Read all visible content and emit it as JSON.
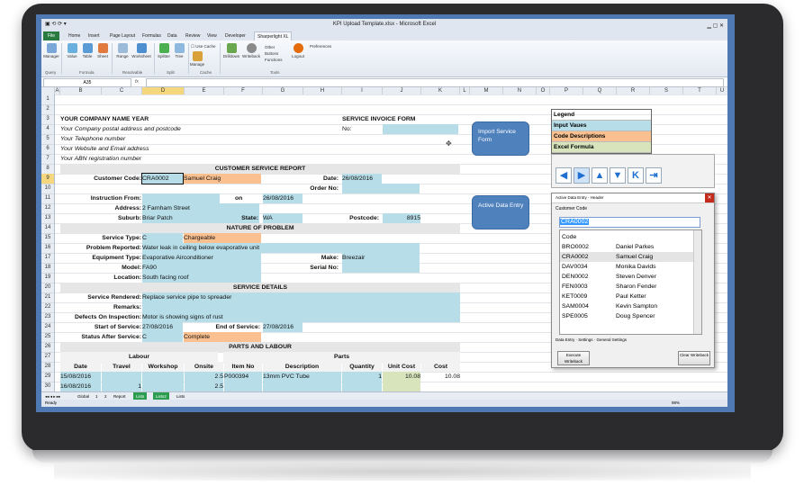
{
  "window": {
    "title": "KPI Upload Template.xlsx - Microsoft Excel"
  },
  "tabs": [
    "File",
    "Home",
    "Insert",
    "Page Layout",
    "Formulas",
    "Data",
    "Review",
    "View",
    "Developer",
    "Sharperlight XL"
  ],
  "ribbon": {
    "buttons": [
      "Manager",
      "Value",
      "Table",
      "Sheet",
      "Range",
      "Worksheet",
      "Splitter",
      "Tree",
      "Use Cache",
      "Manage",
      "Drilldown",
      "Writeback",
      "Other",
      "Buttons",
      "Functions",
      "Logout",
      "Preferences"
    ],
    "groups": [
      "Query",
      "Formula",
      "Resolvable",
      "Split",
      "Cache",
      "Tools"
    ]
  },
  "namebox": "A35",
  "columns": [
    "A",
    "B",
    "C",
    "D",
    "E",
    "F",
    "G",
    "H",
    "I",
    "J",
    "K",
    "L",
    "M",
    "N",
    "O",
    "P",
    "Q",
    "R",
    "S",
    "T",
    "U",
    "V"
  ],
  "rows": [
    "1",
    "2",
    "3",
    "4",
    "5",
    "6",
    "7",
    "8",
    "9",
    "10",
    "11",
    "12",
    "13",
    "14",
    "15",
    "16",
    "17",
    "18",
    "19",
    "20",
    "21",
    "22",
    "23",
    "24",
    "25",
    "26",
    "27",
    "28",
    "29",
    "30"
  ],
  "sheet": {
    "company": "YOUR COMPANY NAME YEAR",
    "address": "Your Company postal address and postcode",
    "phone": "Your Telephone number",
    "web": "Your Website and Email address",
    "abn": "Your ABN registration number",
    "invoice_title": "SERVICE INVOICE FORM",
    "no_label": "No:",
    "report_title": "CUSTOMER SERVICE REPORT",
    "customer_code_label": "Customer Code:",
    "customer_code": "CRA0002",
    "customer_name": "Samuel Craig",
    "date_label": "Date:",
    "date": "26/08/2016",
    "order_label": "Order No:",
    "instruction_label": "Instruction From:",
    "on_label": "on",
    "instruction_date": "26/08/2016",
    "address_label": "Address:",
    "address_value": "2 Farnham Street",
    "suburb_label": "Suburb:",
    "suburb": "Briar Patch",
    "state_label": "State:",
    "state": "WA",
    "postcode_label": "Postcode:",
    "postcode": "8915",
    "nature_title": "NATURE OF PROBLEM",
    "service_type_label": "Service Type:",
    "service_type": "C",
    "service_type_desc": "Chargeable",
    "problem_label": "Problem Reported:",
    "problem": "Water leak in ceiling below evaporative unit",
    "equipment_label": "Equipment Type:",
    "equipment": "Evaporative Airconditioner",
    "make_label": "Make:",
    "make": "Breezair",
    "model_label": "Model:",
    "model": "FA90",
    "serial_label": "Serial No:",
    "location_label": "Location:",
    "location": "South facing roof",
    "details_title": "SERVICE DETAILS",
    "rendered_label": "Service Rendered:",
    "rendered": "Replace service pipe to spreader",
    "remarks_label": "Remarks:",
    "defects_label": "Defects On Inspection:",
    "defects": "Motor is showing signs of rust",
    "start_label": "Start of Service:",
    "start": "27/08/2016",
    "end_label": "End of Service:",
    "end": "27/08/2016",
    "status_label": "Status After Service:",
    "status": "C",
    "status_desc": "Complete",
    "parts_title": "PARTS AND LABOUR",
    "labour_label": "Labour",
    "parts_label": "Parts",
    "table_headers": [
      "Date",
      "Travel",
      "Workshop",
      "Onsite",
      "Item No",
      "Description",
      "Quantity",
      "Unit Cost",
      "Cost"
    ],
    "table_rows": [
      [
        "15/08/2016",
        "",
        "",
        "2.5",
        "P000394",
        "13mm PVC Tube",
        "1",
        "10.08",
        "10.08"
      ],
      [
        "16/08/2016",
        "1",
        "",
        "2.5",
        "",
        "",
        "",
        "",
        ""
      ]
    ]
  },
  "nav": {
    "import": "Import Service Form",
    "active": "Active Data Entry"
  },
  "legend": {
    "title": "Legend",
    "items": [
      "Input Vaues",
      "Code Descriptions",
      "Excel Formula"
    ],
    "colors": [
      "#b6dde8",
      "#fac090",
      "#d7e4bc"
    ]
  },
  "arrows": [
    "arrow-left-icon",
    "arrow-right-icon",
    "arrow-up-icon",
    "arrow-down-icon",
    "first-icon",
    "last-icon"
  ],
  "dialog": {
    "title": "Active Data Entry - Header",
    "field_label": "Customer Code",
    "search": "CRA0002",
    "list_header": "Code",
    "items": [
      [
        "BRO0002",
        "Daniel Parkes"
      ],
      [
        "CRA0002",
        "Samuel Craig"
      ],
      [
        "DAV0034",
        "Monika Davids"
      ],
      [
        "DEN0002",
        "Steven Denver"
      ],
      [
        "FEN0003",
        "Sharon Fender"
      ],
      [
        "KET0009",
        "Paul Ketter"
      ],
      [
        "SAM0004",
        "Kevin Sampton"
      ],
      [
        "SPE0005",
        "Doug Spencer"
      ]
    ],
    "tabs": [
      "Data Entry",
      "Settings",
      "General Settings"
    ],
    "btn_left": "Execute Writeback",
    "btn_right": "Clear Writeback"
  },
  "sheet_tabs": [
    "Global",
    "1",
    "2",
    "Report",
    "Lists",
    "Lists2",
    "Lists"
  ],
  "status": {
    "left": "Ready",
    "zoom": "98%"
  }
}
